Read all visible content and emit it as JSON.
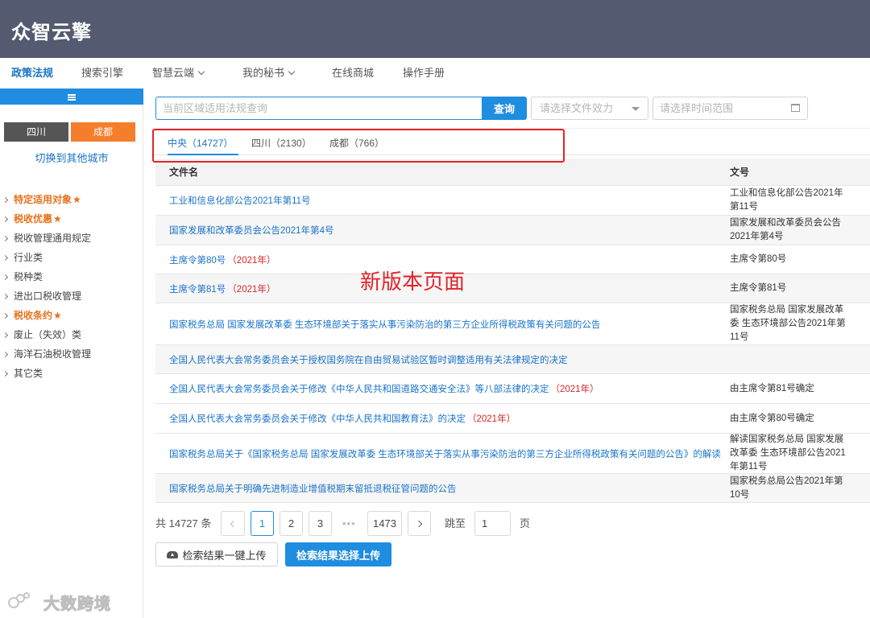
{
  "app": {
    "logo": "众智云擎"
  },
  "nav": {
    "items": [
      {
        "label": "政策法规",
        "active": true,
        "dropdown": false
      },
      {
        "label": "搜索引擎",
        "active": false,
        "dropdown": false
      },
      {
        "label": "智慧云端",
        "active": false,
        "dropdown": true
      },
      {
        "label": "我的秘书",
        "active": false,
        "dropdown": true
      },
      {
        "label": "在线商城",
        "active": false,
        "dropdown": false
      },
      {
        "label": "操作手册",
        "active": false,
        "dropdown": false
      }
    ]
  },
  "sidebar": {
    "city_sichuan": "四川",
    "city_chengdu": "成都",
    "switch_city": "切换到其他城市",
    "categories": [
      {
        "label": "特定适用对象",
        "highlight": true,
        "star": "★"
      },
      {
        "label": "税收优惠",
        "highlight": true,
        "star": "★"
      },
      {
        "label": "税收管理通用规定",
        "highlight": false,
        "star": ""
      },
      {
        "label": "行业类",
        "highlight": false,
        "star": ""
      },
      {
        "label": "税种类",
        "highlight": false,
        "star": ""
      },
      {
        "label": "进出口税收管理",
        "highlight": false,
        "star": ""
      },
      {
        "label": "税收条约",
        "highlight": true,
        "star": "★"
      },
      {
        "label": "废止（失效）类",
        "highlight": false,
        "star": ""
      },
      {
        "label": "海洋石油税收管理",
        "highlight": false,
        "star": ""
      },
      {
        "label": "其它类",
        "highlight": false,
        "star": ""
      }
    ]
  },
  "search": {
    "placeholder": "当前区域适用法规查询",
    "button": "查询",
    "effect_placeholder": "请选择文件效力",
    "time_placeholder": "请选择时间范围"
  },
  "tabs": [
    {
      "label": "中央（14727）",
      "active": true
    },
    {
      "label": "四川（2130）",
      "active": false
    },
    {
      "label": "成都（766）",
      "active": false
    }
  ],
  "table": {
    "headers": {
      "name": "文件名",
      "number": "文号"
    },
    "rows": [
      {
        "name": "工业和信息化部公告2021年第11号",
        "year": "",
        "number": "工业和信息化部公告2021年第11号"
      },
      {
        "name": "国家发展和改革委员会公告2021年第4号",
        "year": "",
        "number": "国家发展和改革委员会公告2021年第4号"
      },
      {
        "name": "主席令第80号",
        "year": "（2021年）",
        "number": "主席令第80号"
      },
      {
        "name": "主席令第81号",
        "year": "（2021年）",
        "number": "主席令第81号"
      },
      {
        "name": "国家税务总局 国家发展改革委 生态环境部关于落实从事污染防治的第三方企业所得税政策有关问题的公告",
        "year": "",
        "number": "国家税务总局 国家发展改革委 生态环境部公告2021年第11号"
      },
      {
        "name": "全国人民代表大会常务委员会关于授权国务院在自由贸易试验区暂时调整适用有关法律规定的决定",
        "year": "",
        "number": ""
      },
      {
        "name": "全国人民代表大会常务委员会关于修改《中华人民共和国道路交通安全法》等八部法律的决定",
        "year": "（2021年）",
        "number": "由主席令第81号确定"
      },
      {
        "name": "全国人民代表大会常务委员会关于修改《中华人民共和国教育法》的决定",
        "year": "（2021年）",
        "number": "由主席令第80号确定"
      },
      {
        "name": "国家税务总局关于《国家税务总局 国家发展改革委 生态环境部关于落实从事污染防治的第三方企业所得税政策有关问题的公告》的解读",
        "year": "",
        "number": "解读国家税务总局 国家发展改革委 生态环境部公告2021年第11号"
      },
      {
        "name": "国家税务总局关于明确先进制造业增值税期末留抵退税征管问题的公告",
        "year": "",
        "number": "国家税务总局公告2021年第10号"
      }
    ]
  },
  "annotation": "新版本页面",
  "pagination": {
    "total": "共 14727 条",
    "pages": [
      "1",
      "2",
      "3",
      "1473"
    ],
    "current": "1",
    "ellipsis": "•••",
    "jump_label": "跳至",
    "jump_value": "1",
    "page_unit": "页"
  },
  "actions": {
    "upload_all": "检索结果一键上传",
    "upload_selected": "检索结果选择上传"
  },
  "watermark": {
    "text": "大数跨境"
  },
  "colors": {
    "header": "#545b70",
    "accent": "#1f8de0",
    "orange": "#f47e2b",
    "highlight": "#e0242a"
  }
}
